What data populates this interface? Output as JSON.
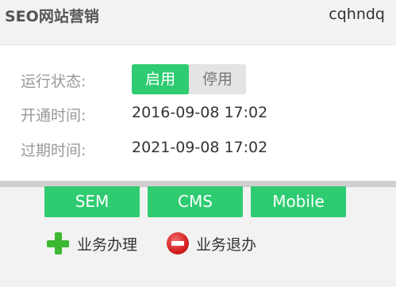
{
  "header": {
    "title": "SEO网站营销",
    "username": "cqhndq"
  },
  "details": {
    "status_label": "运行状态:",
    "status_on": "启用",
    "status_off": "停用",
    "status_selected": "启用",
    "open_label": "开通时间:",
    "open_value": "2016-09-08 17:02",
    "expire_label": "过期时间:",
    "expire_value": "2021-09-08 17:02"
  },
  "services": [
    "SEM",
    "CMS",
    "Mobile"
  ],
  "actions": {
    "handle_label": "业务办理",
    "cancel_label": "业务退办"
  },
  "colors": {
    "accent": "#2ecb71",
    "plus_icon": "#3cb832",
    "minus_icon": "#d42020"
  },
  "icons": {
    "handle": "plus-icon",
    "cancel": "minus-circle-icon"
  }
}
